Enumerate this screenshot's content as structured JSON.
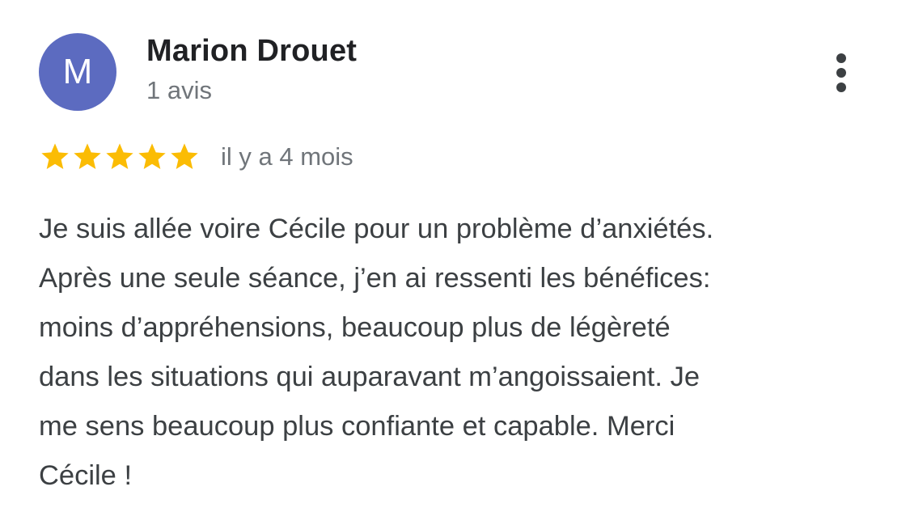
{
  "review": {
    "author": {
      "initial": "M",
      "name": "Marion Drouet",
      "review_count": "1 avis",
      "avatar_color": "#5c6bc0"
    },
    "rating": {
      "stars": 5,
      "max_stars": 5,
      "star_color": "#fbbc04",
      "icon": "star-icon"
    },
    "date": "il y a 4 mois",
    "text_lines": [
      "Je suis allée voire Cécile pour un problème d’anxiétés.",
      "Après une seule séance, j’en ai ressenti les bénéfices:",
      "moins d’appréhensions, beaucoup plus de légèreté",
      "dans les situations qui auparavant m’angoissaient. Je",
      "me sens beaucoup plus confiante et capable. Merci",
      "Cécile !"
    ],
    "menu_icon": "more-vertical-icon"
  }
}
